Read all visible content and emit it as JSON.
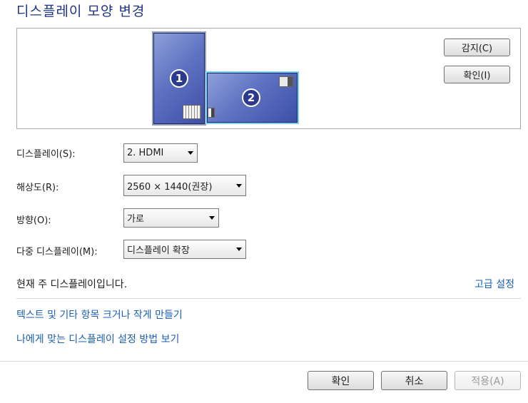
{
  "header": {
    "title": "디스플레이 모양 변경"
  },
  "preview": {
    "monitor1_number": "1",
    "monitor2_number": "2",
    "detect_label": "감지(C)",
    "identify_label": "확인(I)"
  },
  "settings": {
    "display_label": "디스플레이(S):",
    "display_value": "2. HDMI",
    "resolution_label": "해상도(R):",
    "resolution_value": "2560 × 1440(권장)",
    "orientation_label": "방향(O):",
    "orientation_value": "가로",
    "multi_label": "다중 디스플레이(M):",
    "multi_value": "디스플레이 확장"
  },
  "status_text": "현재 주 디스플레이입니다.",
  "links": {
    "advanced": "고급 설정",
    "text_size": "텍스트 및 기타 항목 크거나 작게 만들기",
    "help": "나에게 맞는 디스플레이 설정 방법 보기"
  },
  "footer": {
    "ok": "확인",
    "cancel": "취소",
    "apply": "적용(A)"
  },
  "colors": {
    "title": "#1e3287",
    "link": "#1a5fb4",
    "monitor": "#5f72c2",
    "selected_outline": "#7fd0f0"
  }
}
